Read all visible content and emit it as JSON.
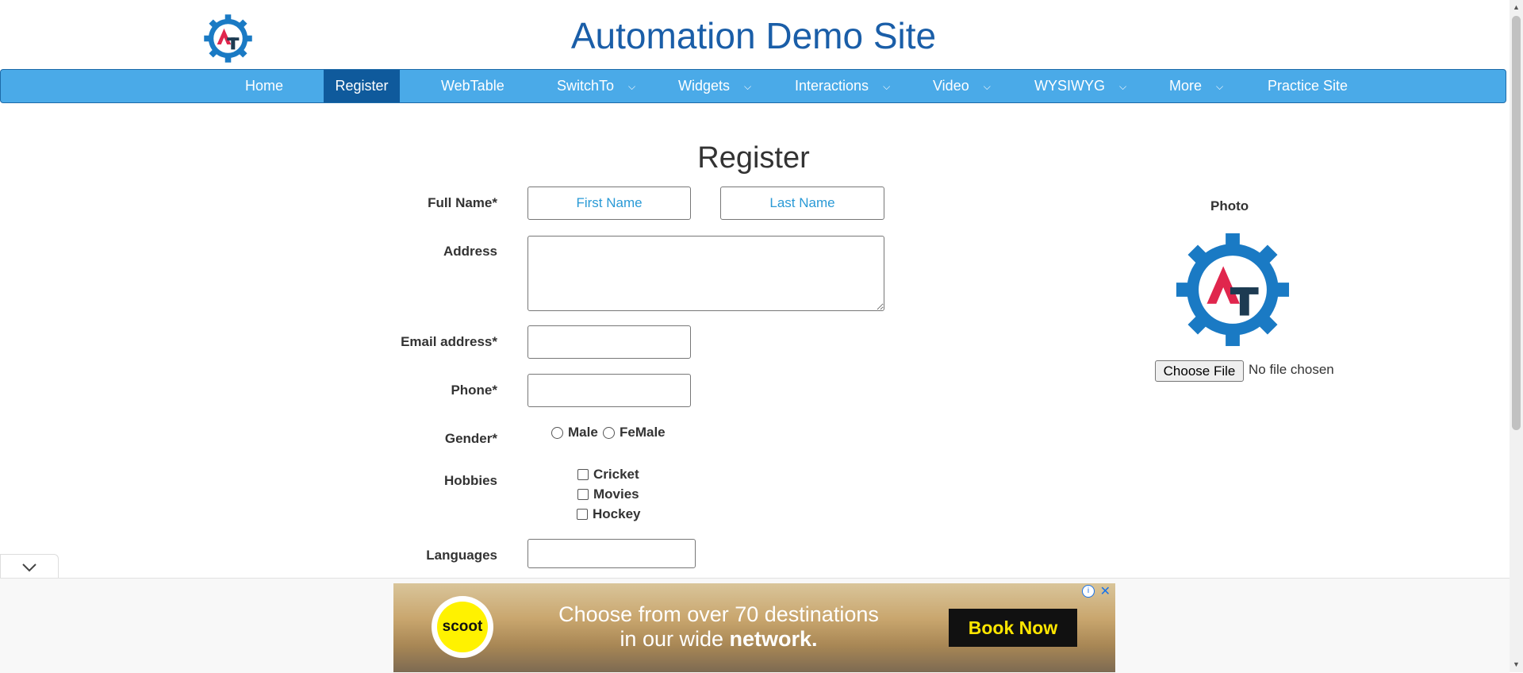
{
  "header": {
    "title": "Automation Demo Site",
    "logo_letters": "AT"
  },
  "nav": {
    "items": [
      {
        "label": "Home",
        "dropdown": false,
        "active": false
      },
      {
        "label": "Register",
        "dropdown": false,
        "active": true
      },
      {
        "label": "WebTable",
        "dropdown": false,
        "active": false
      },
      {
        "label": "SwitchTo",
        "dropdown": true,
        "active": false
      },
      {
        "label": "Widgets",
        "dropdown": true,
        "active": false
      },
      {
        "label": "Interactions",
        "dropdown": true,
        "active": false
      },
      {
        "label": "Video",
        "dropdown": true,
        "active": false
      },
      {
        "label": "WYSIWYG",
        "dropdown": true,
        "active": false
      },
      {
        "label": "More",
        "dropdown": true,
        "active": false
      },
      {
        "label": "Practice Site",
        "dropdown": false,
        "active": false
      }
    ]
  },
  "form": {
    "heading": "Register",
    "full_name_label": "Full Name*",
    "first_name_placeholder": "First Name",
    "last_name_placeholder": "Last Name",
    "address_label": "Address",
    "email_label": "Email address*",
    "phone_label": "Phone*",
    "gender_label": "Gender*",
    "gender_options": [
      "Male",
      "FeMale"
    ],
    "hobbies_label": "Hobbies",
    "hobbies": [
      "Cricket",
      "Movies",
      "Hockey"
    ],
    "languages_label": "Languages"
  },
  "photo": {
    "label": "Photo",
    "file_button": "Choose File",
    "file_status": "No file chosen"
  },
  "ad": {
    "brand": "scoot",
    "text_line1": "Choose from over 70 destinations",
    "text_line2_plain": "in our wide ",
    "text_line2_bold": "network.",
    "cta": "Book Now"
  },
  "colors": {
    "nav_bg": "#4aaae8",
    "nav_active": "#0f5a9c",
    "title": "#1a5ea8",
    "placeholder": "#2a9ad6"
  }
}
